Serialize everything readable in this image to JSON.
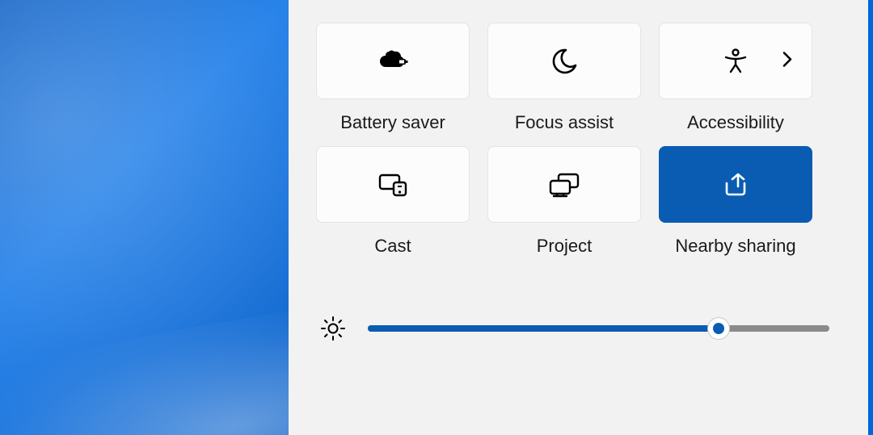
{
  "tiles": {
    "battery_saver": {
      "label": "Battery saver",
      "active": false
    },
    "focus_assist": {
      "label": "Focus assist",
      "active": false
    },
    "accessibility": {
      "label": "Accessibility",
      "active": false,
      "has_chevron": true
    },
    "cast": {
      "label": "Cast",
      "active": false
    },
    "project": {
      "label": "Project",
      "active": false
    },
    "nearby_sharing": {
      "label": "Nearby sharing",
      "active": true
    }
  },
  "brightness": {
    "percent": 76
  },
  "colors": {
    "accent": "#0a5cb2",
    "panel_bg": "#f2f2f2",
    "tile_bg": "#fcfcfc"
  }
}
